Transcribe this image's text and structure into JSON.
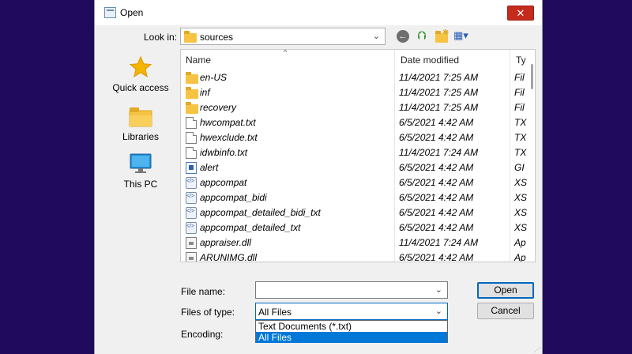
{
  "window": {
    "title": "Open",
    "close_glyph": "✕"
  },
  "toolbar": {
    "look_in_label": "Look in:",
    "look_in_value": "sources",
    "back_glyph": "←",
    "up_glyph": "⮉",
    "view_glyph": "▦▾"
  },
  "sidebar": {
    "items": [
      {
        "label": "Quick access",
        "icon": "star-icon"
      },
      {
        "label": "Libraries",
        "icon": "libraries-icon"
      },
      {
        "label": "This PC",
        "icon": "monitor-icon"
      }
    ]
  },
  "list": {
    "columns": {
      "name": "Name",
      "date": "Date modified",
      "type": "Ty"
    },
    "rows": [
      {
        "name": "en-US",
        "date": "11/4/2021 7:25 AM",
        "type": "Fil",
        "icon": "folder"
      },
      {
        "name": "inf",
        "date": "11/4/2021 7:25 AM",
        "type": "Fil",
        "icon": "folder"
      },
      {
        "name": "recovery",
        "date": "11/4/2021 7:25 AM",
        "type": "Fil",
        "icon": "folder"
      },
      {
        "name": "hwcompat.txt",
        "date": "6/5/2021 4:42 AM",
        "type": "TX",
        "icon": "file"
      },
      {
        "name": "hwexclude.txt",
        "date": "6/5/2021 4:42 AM",
        "type": "TX",
        "icon": "file"
      },
      {
        "name": "idwbinfo.txt",
        "date": "11/4/2021 7:24 AM",
        "type": "TX",
        "icon": "file"
      },
      {
        "name": "alert",
        "date": "6/5/2021 4:42 AM",
        "type": "GI",
        "icon": "gif"
      },
      {
        "name": "appcompat",
        "date": "6/5/2021 4:42 AM",
        "type": "XS",
        "icon": "xsl"
      },
      {
        "name": "appcompat_bidi",
        "date": "6/5/2021 4:42 AM",
        "type": "XS",
        "icon": "xsl"
      },
      {
        "name": "appcompat_detailed_bidi_txt",
        "date": "6/5/2021 4:42 AM",
        "type": "XS",
        "icon": "xsl"
      },
      {
        "name": "appcompat_detailed_txt",
        "date": "6/5/2021 4:42 AM",
        "type": "XS",
        "icon": "xsl"
      },
      {
        "name": "appraiser.dll",
        "date": "11/4/2021 7:24 AM",
        "type": "Ap",
        "icon": "dll"
      },
      {
        "name": "ARUNIMG.dll",
        "date": "6/5/2021 4:42 AM",
        "type": "Ap",
        "icon": "dll"
      }
    ]
  },
  "form": {
    "file_name_label": "File name:",
    "file_name_value": "",
    "files_of_type_label": "Files of type:",
    "files_of_type_value": "All Files",
    "encoding_label": "Encoding:",
    "type_options": [
      "Text Documents (*.txt)",
      "All Files"
    ],
    "open_label": "Open",
    "cancel_label": "Cancel"
  },
  "colors": {
    "background": "#1f0a5e",
    "close_button": "#c42b1c",
    "selection": "#0078d7",
    "folder": "#f6c342"
  }
}
